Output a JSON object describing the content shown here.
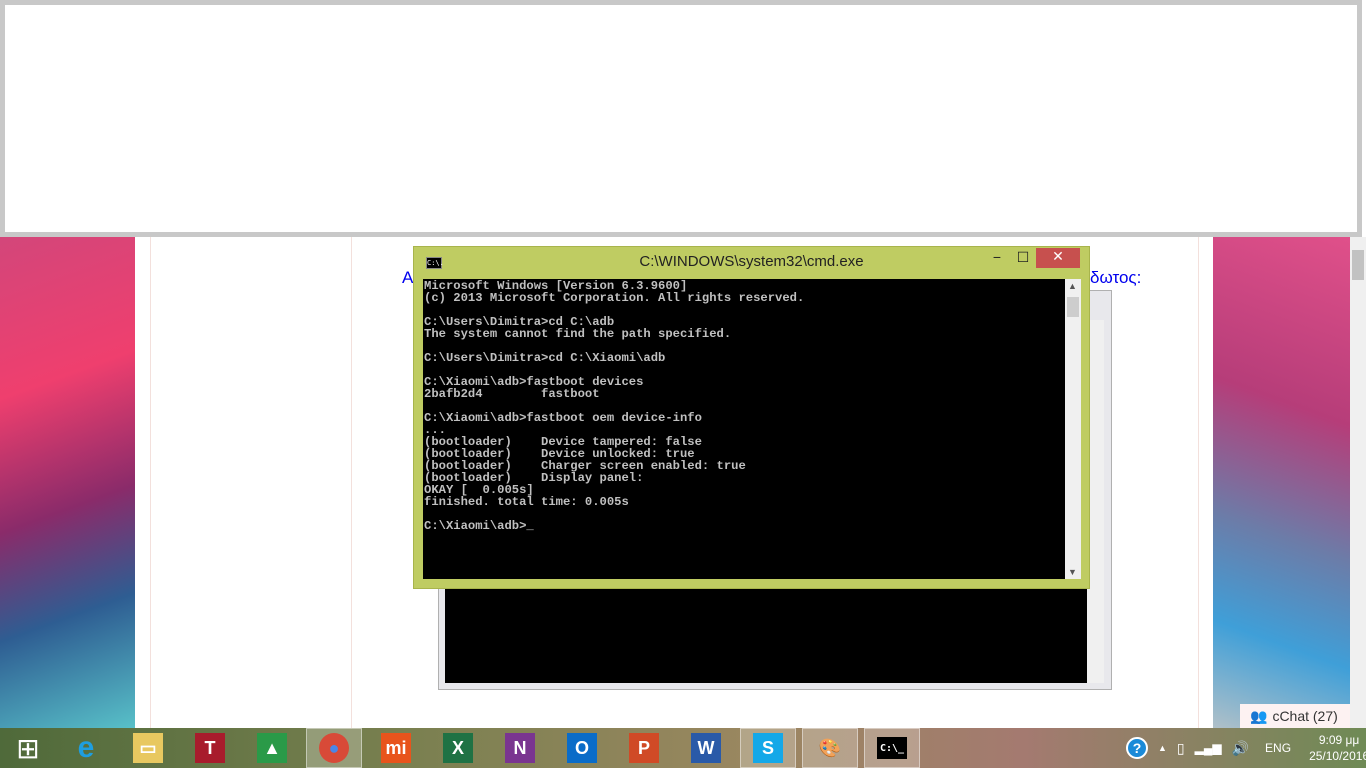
{
  "page": {
    "text_left": "Α",
    "text_right": "δωτος:"
  },
  "cmd": {
    "title": "C:\\WINDOWS\\system32\\cmd.exe",
    "icon_label": "C:\\.",
    "minimize": "−",
    "maximize": "☐",
    "close": "✕",
    "lines": [
      "Microsoft Windows [Version 6.3.9600]",
      "(c) 2013 Microsoft Corporation. All rights reserved.",
      "",
      "C:\\Users\\Dimitra>cd C:\\adb",
      "The system cannot find the path specified.",
      "",
      "C:\\Users\\Dimitra>cd C:\\Xiaomi\\adb",
      "",
      "C:\\Xiaomi\\adb>fastboot devices",
      "2bafb2d4        fastboot",
      "",
      "C:\\Xiaomi\\adb>fastboot oem device-info",
      "...",
      "(bootloader)    Device tampered: false",
      "(bootloader)    Device unlocked: true",
      "(bootloader)    Charger screen enabled: true",
      "(bootloader)    Display panel:",
      "OKAY [  0.005s]",
      "finished. total time: 0.005s",
      "",
      "C:\\Xiaomi\\adb>_"
    ]
  },
  "chat": {
    "label": "cChat (27)"
  },
  "taskbar": {
    "apps": [
      {
        "name": "start",
        "glyph": "⊞",
        "color": "transparent"
      },
      {
        "name": "internet-explorer",
        "glyph": "e",
        "color": "#1e9ee0"
      },
      {
        "name": "file-explorer",
        "glyph": "▭",
        "color": "#e8c860"
      },
      {
        "name": "t-app",
        "glyph": "T",
        "color": "#a81c2c"
      },
      {
        "name": "google-drive",
        "glyph": "▲",
        "color": "#2a9a48"
      },
      {
        "name": "chrome",
        "glyph": "●",
        "color": "#d84a38"
      },
      {
        "name": "mi",
        "glyph": "mi",
        "color": "#e8541c"
      },
      {
        "name": "excel",
        "glyph": "X",
        "color": "#1f7244"
      },
      {
        "name": "onenote",
        "glyph": "N",
        "color": "#7a3590"
      },
      {
        "name": "outlook",
        "glyph": "O",
        "color": "#0a6cc8"
      },
      {
        "name": "powerpoint",
        "glyph": "P",
        "color": "#d04a26"
      },
      {
        "name": "word",
        "glyph": "W",
        "color": "#2a5aa8"
      },
      {
        "name": "skype",
        "glyph": "S",
        "color": "#14a8e8"
      },
      {
        "name": "paint",
        "glyph": "🎨",
        "color": "transparent"
      },
      {
        "name": "cmd",
        "glyph": "C:\\_",
        "color": "#000"
      }
    ],
    "tray": {
      "lang": "ENG",
      "time": "9:09 μμ",
      "date": "25/10/2016"
    }
  }
}
